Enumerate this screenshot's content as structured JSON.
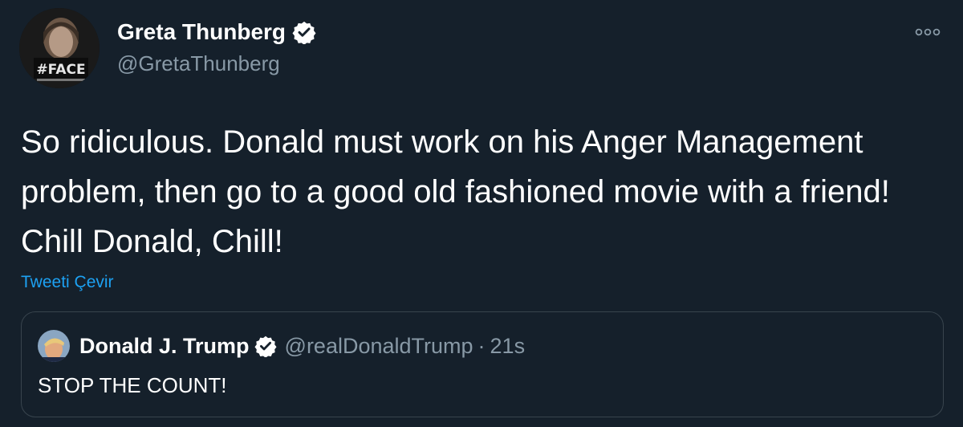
{
  "author": {
    "name": "Greta Thunberg",
    "handle": "@GretaThunberg",
    "avatar_badge_text": "#FACE"
  },
  "tweet": {
    "text": "So ridiculous. Donald must work on his Anger Management problem, then go to a good old fashioned movie with a friend! Chill Donald, Chill!",
    "translate_label": "Tweeti Çevir"
  },
  "quoted_tweet": {
    "name": "Donald J. Trump",
    "handle": "@realDonaldTrump",
    "separator": "·",
    "time": "21s",
    "text": "STOP THE COUNT!"
  },
  "icons": {
    "verified": "verified-badge-icon",
    "more": "more-options-icon"
  },
  "colors": {
    "background": "#15202b",
    "primary_text": "#ffffff",
    "secondary_text": "#8899a6",
    "accent": "#1da1f2",
    "border": "#38444d"
  }
}
